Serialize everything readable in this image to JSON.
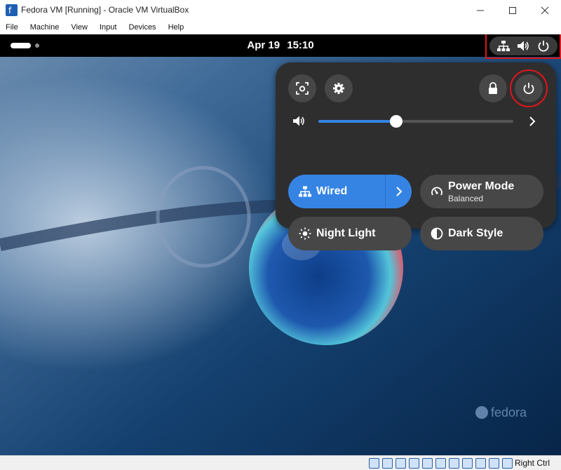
{
  "window": {
    "title": "Fedora VM [Running] - Oracle VM VirtualBox",
    "menu": [
      "File",
      "Machine",
      "View",
      "Input",
      "Devices",
      "Help"
    ]
  },
  "topbar": {
    "date": "Apr 19",
    "time": "15:10",
    "status_icons": [
      "network-wired-icon",
      "volume-icon",
      "power-icon"
    ]
  },
  "quick_settings": {
    "top_buttons": [
      "screenshot-icon",
      "settings-icon",
      "lock-icon",
      "power-icon"
    ],
    "volume": {
      "level": 0.4
    },
    "tiles": [
      {
        "label": "Wired",
        "subtitle": "",
        "icon": "network-wired-icon",
        "active": true
      },
      {
        "label": "Power Mode",
        "subtitle": "Balanced",
        "icon": "speedometer-icon",
        "active": false
      },
      {
        "label": "Night Light",
        "subtitle": "",
        "icon": "sun-icon",
        "active": false
      },
      {
        "label": "Dark Style",
        "subtitle": "",
        "icon": "half-circle-icon",
        "active": false
      }
    ]
  },
  "wallpaper": {
    "watermark": "fedora"
  },
  "statusbar": {
    "host_key": "Right Ctrl"
  },
  "colors": {
    "accent": "#3584e4",
    "panel": "#2e2e2e",
    "tile": "#474747",
    "highlight": "#e0151c"
  }
}
